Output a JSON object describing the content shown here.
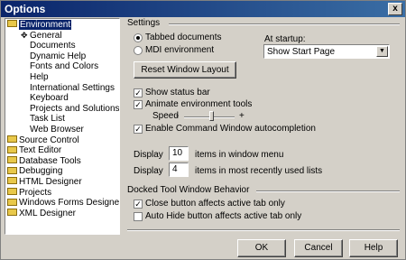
{
  "window": {
    "title": "Options",
    "close_glyph": "x"
  },
  "tree": {
    "items": [
      {
        "label": "Environment",
        "type": "folder",
        "selected": true
      },
      {
        "label": "General",
        "type": "leaf",
        "current": true
      },
      {
        "label": "Documents",
        "type": "leaf"
      },
      {
        "label": "Dynamic Help",
        "type": "leaf"
      },
      {
        "label": "Fonts and Colors",
        "type": "leaf"
      },
      {
        "label": "Help",
        "type": "leaf"
      },
      {
        "label": "International Settings",
        "type": "leaf"
      },
      {
        "label": "Keyboard",
        "type": "leaf"
      },
      {
        "label": "Projects and Solutions",
        "type": "leaf"
      },
      {
        "label": "Task List",
        "type": "leaf"
      },
      {
        "label": "Web Browser",
        "type": "leaf"
      },
      {
        "label": "Source Control",
        "type": "folder"
      },
      {
        "label": "Text Editor",
        "type": "folder"
      },
      {
        "label": "Database Tools",
        "type": "folder"
      },
      {
        "label": "Debugging",
        "type": "folder"
      },
      {
        "label": "HTML Designer",
        "type": "folder"
      },
      {
        "label": "Projects",
        "type": "folder"
      },
      {
        "label": "Windows Forms Designer",
        "type": "folder"
      },
      {
        "label": "XML Designer",
        "type": "folder"
      }
    ]
  },
  "settings": {
    "heading": "Settings",
    "tabbed_label": "Tabbed documents",
    "mdi_label": "MDI environment",
    "tabbed_selected": true,
    "at_startup_label": "At startup:",
    "at_startup_value": "Show Start Page",
    "reset_button": "Reset Window Layout",
    "show_status_bar": "Show status bar",
    "animate_tools": "Animate environment tools",
    "speed_label": "Speed",
    "speed_minus": "-",
    "speed_plus": "+",
    "speed_level": 0.55,
    "enable_command_window": "Enable Command Window autocompletion",
    "display_label": "Display",
    "window_menu_count": "10",
    "window_menu_suffix": "items in window menu",
    "mru_count": "4",
    "mru_suffix": "items in most recently used lists"
  },
  "docked": {
    "heading": "Docked Tool Window Behavior",
    "close_button": "Close button affects active tab only",
    "auto_hide": "Auto Hide button affects active tab only"
  },
  "footer": {
    "ok": "OK",
    "cancel": "Cancel",
    "help": "Help"
  }
}
